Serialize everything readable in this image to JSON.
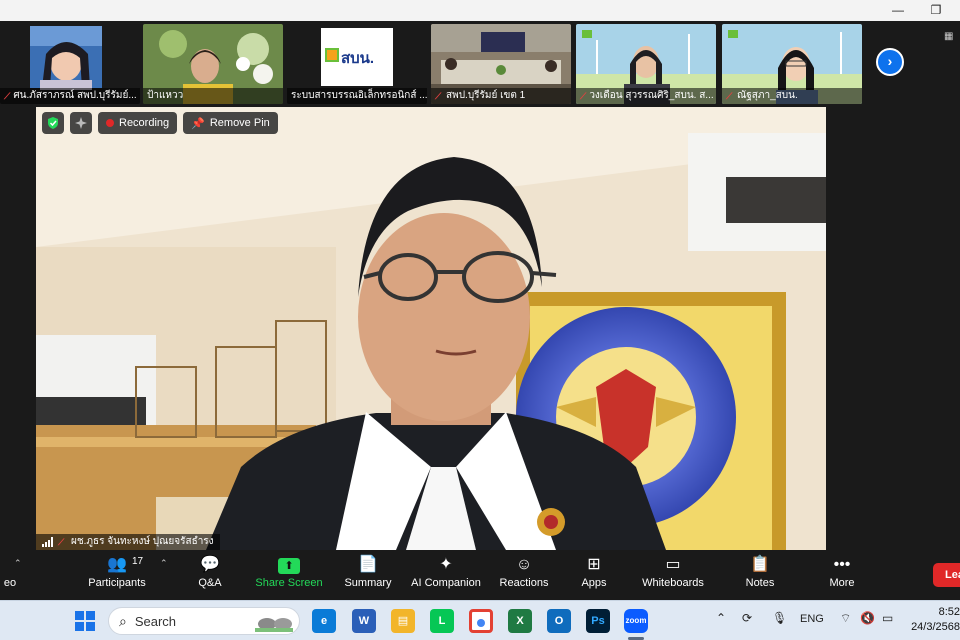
{
  "window": {
    "restore_icon": "restore-icon",
    "minimize_icon": "minimize-icon"
  },
  "gallery": {
    "tiles": [
      {
        "name": "ศน.ภัสราภรณ์ สพป.บุรีรัมย์..."
      },
      {
        "name": "ป้าแหวว"
      },
      {
        "name": "ระบบสารบรรณอิเล็กทรอนิกส์ ..."
      },
      {
        "name": "สพป.บุรีรัมย์ เขต 1"
      },
      {
        "name": "วงเดือน สุวรรณศิริ_สบน. ส..."
      },
      {
        "name": "ณัฐสุภา_สบน."
      }
    ],
    "logo_text": "สบน."
  },
  "main_video": {
    "recording_label": "Recording",
    "remove_pin_label": "Remove Pin",
    "speaker_name": "ผช.ภูธร จันทะหงษ์ ปุณยจรัสธำรง"
  },
  "toolbar": {
    "video_label": "eo",
    "participants_label": "Participants",
    "participants_count": "17",
    "qa_label": "Q&A",
    "share_label": "Share Screen",
    "summary_label": "Summary",
    "ai_label": "AI Companion",
    "reactions_label": "Reactions",
    "apps_label": "Apps",
    "whiteboards_label": "Whiteboards",
    "notes_label": "Notes",
    "more_label": "More",
    "leave_label": "Lea"
  },
  "taskbar": {
    "search_placeholder": "Search",
    "lang": "ENG",
    "time": "8:52",
    "date": "24/3/2568",
    "apps": [
      "edge",
      "word",
      "file-explorer",
      "line",
      "chrome",
      "excel",
      "outlook",
      "photoshop",
      "zoom"
    ]
  },
  "colors": {
    "accent_green": "#23d959",
    "leave_red": "#e02828",
    "zoom_blue": "#0e72ed"
  }
}
